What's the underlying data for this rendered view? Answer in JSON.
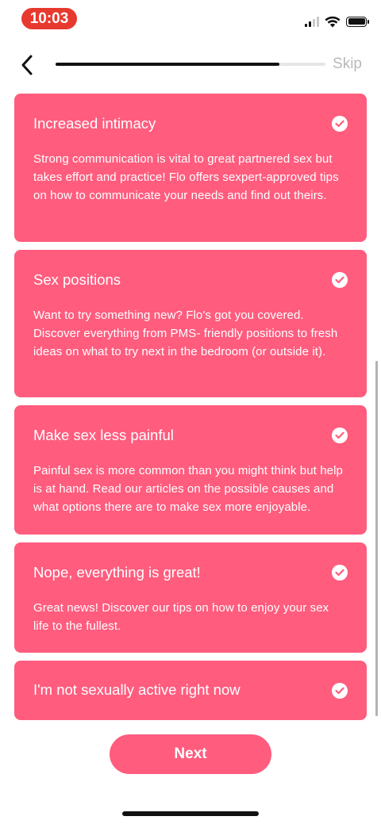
{
  "status_bar": {
    "time": "10:03",
    "time_pill_color": "#e8392f",
    "icons": [
      "cellular-signal-icon",
      "wifi-icon",
      "battery-icon"
    ]
  },
  "nav": {
    "back_icon": "chevron-left-icon",
    "progress_fraction": 0.83,
    "skip_label": "Skip"
  },
  "accent_color": "#ff5c7e",
  "options": [
    {
      "title": "Increased intimacy",
      "description": "Strong communication is vital to great partnered sex but takes effort and practice! Flo offers sexpert-approved tips on how to communicate your needs and find out theirs.",
      "selected": true
    },
    {
      "title": "Sex positions",
      "description": "Want to try something new? Flo's got you covered. Discover everything from PMS- friendly positions to fresh ideas on what to try next in the bedroom (or outside it).",
      "selected": true
    },
    {
      "title": "Make sex less painful",
      "description": "Painful sex is more common than you might think but help is at hand. Read our articles on the possible causes and what options there are to make sex more enjoyable.",
      "selected": true
    },
    {
      "title": "Nope, everything is great!",
      "description": "Great news! Discover our tips on how to enjoy your sex life to the fullest.",
      "selected": true
    },
    {
      "title": "I'm not sexually active right now",
      "description": "",
      "selected": true
    }
  ],
  "next_label": "Next"
}
